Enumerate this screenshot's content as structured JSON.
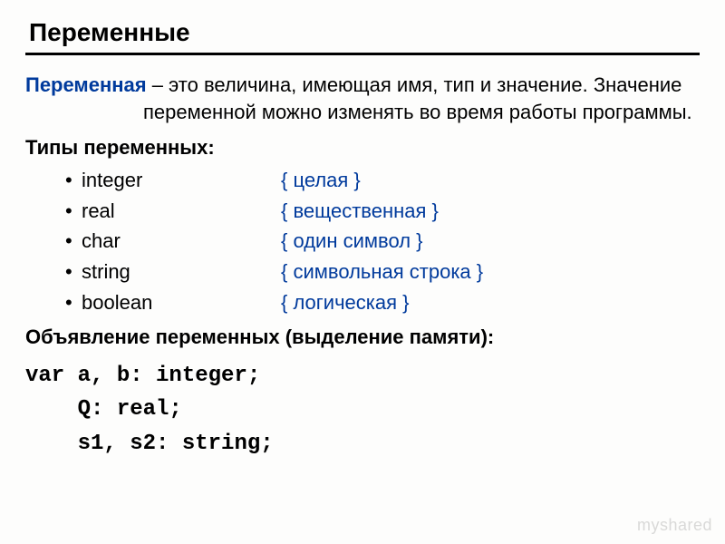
{
  "title": "Переменные",
  "definition": {
    "term": "Переменная",
    "text": " – это величина, имеющая имя, тип и значение. Значение переменной можно изменять во время работы программы."
  },
  "types_heading": "Типы переменных:",
  "types": [
    {
      "name": "integer",
      "desc": "{ целая }"
    },
    {
      "name": "real",
      "desc": "{ вещественная }"
    },
    {
      "name": "char",
      "desc": "{ один символ }"
    },
    {
      "name": "string",
      "desc": "{ символьная строка }"
    },
    {
      "name": "boolean",
      "desc": "{ логическая }"
    }
  ],
  "declaration_heading": "Объявление переменных (выделение памяти):",
  "code_lines": [
    "var a, b: integer;",
    "    Q: real;",
    "    s1, s2: string;"
  ],
  "watermark": "myshared"
}
